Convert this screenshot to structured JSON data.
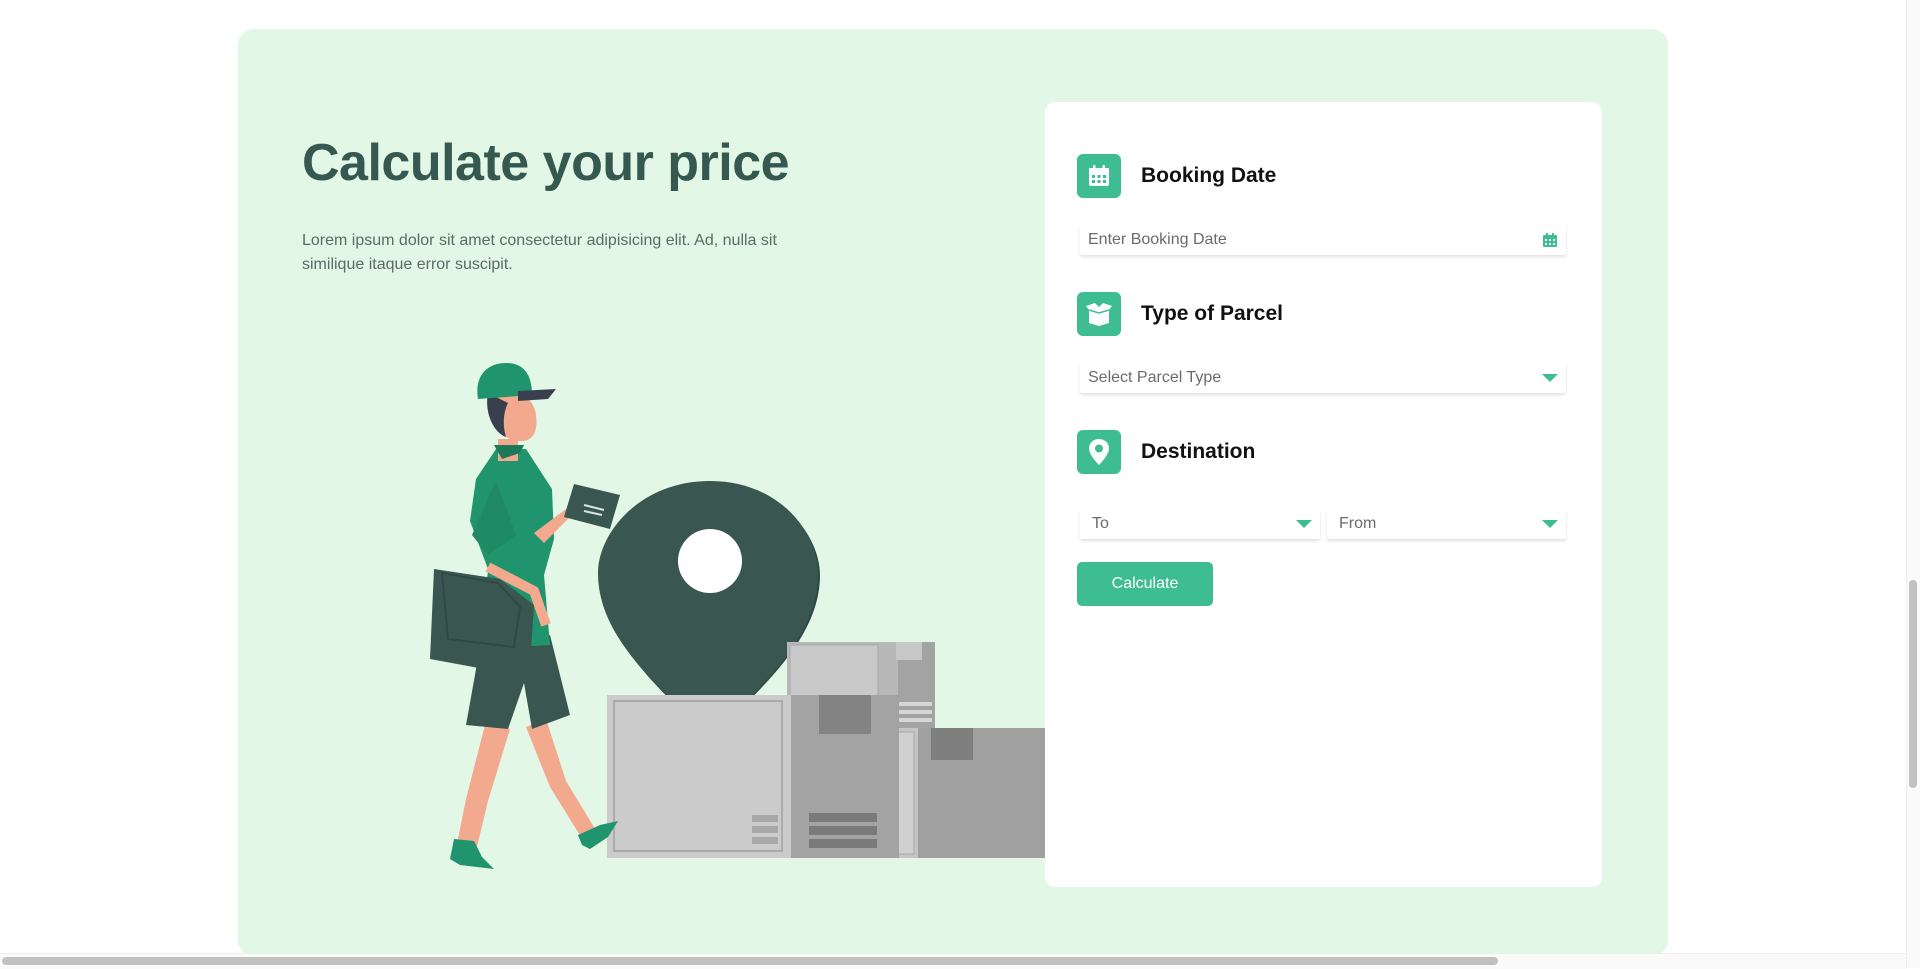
{
  "hero": {
    "title": "Calculate your price",
    "description": "Lorem ipsum dolor sit amet consectetur adipisicing elit. Ad, nulla sit similique itaque error suscipit."
  },
  "form": {
    "booking": {
      "title": "Booking Date",
      "placeholder": "Enter Booking Date",
      "icon": "calendar-icon"
    },
    "parcel": {
      "title": "Type of Parcel",
      "placeholder": "Select Parcel Type",
      "icon": "box-icon"
    },
    "destination": {
      "title": "Destination",
      "to": "To",
      "from": "From",
      "icon": "map-pin-icon"
    },
    "calculate_label": "Calculate"
  },
  "colors": {
    "accent": "#3ebd93",
    "section_bg": "#e2f7e6",
    "heading": "#355850"
  }
}
